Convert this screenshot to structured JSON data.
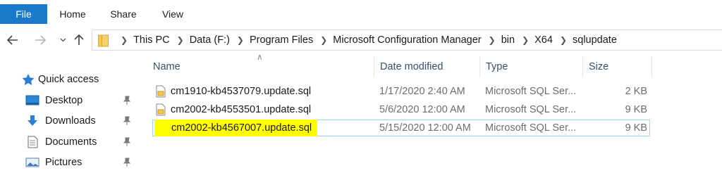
{
  "ribbon": {
    "tabs": [
      "File",
      "Home",
      "Share",
      "View"
    ]
  },
  "address": {
    "crumbs": [
      "This PC",
      "Data (F:)",
      "Program Files",
      "Microsoft Configuration Manager",
      "bin",
      "X64",
      "sqlupdate"
    ]
  },
  "navpane": {
    "items": [
      {
        "label": "Quick access",
        "icon": "star-icon",
        "pinned": false
      },
      {
        "label": "Desktop",
        "icon": "desktop-icon",
        "pinned": true
      },
      {
        "label": "Downloads",
        "icon": "download-arrow-icon",
        "pinned": true
      },
      {
        "label": "Documents",
        "icon": "document-icon",
        "pinned": true
      },
      {
        "label": "Pictures",
        "icon": "pictures-icon",
        "pinned": true
      }
    ]
  },
  "list": {
    "columns": {
      "name": "Name",
      "date": "Date modified",
      "type": "Type",
      "size": "Size"
    },
    "rows": [
      {
        "name": "cm1910-kb4537079.update.sql",
        "date": "1/17/2020 2:40 AM",
        "type": "Microsoft SQL Ser...",
        "size": "2 KB",
        "selected": false
      },
      {
        "name": "cm2002-kb4553501.update.sql",
        "date": "5/6/2020 12:00 AM",
        "type": "Microsoft SQL Ser...",
        "size": "9 KB",
        "selected": false
      },
      {
        "name": "cm2002-kb4567007.update.sql",
        "date": "5/15/2020 12:00 AM",
        "type": "Microsoft SQL Ser...",
        "size": "9 KB",
        "selected": true
      }
    ]
  },
  "colors": {
    "file_tab": "#1979ca",
    "selection_border": "#99d1ff",
    "highlight": "#ffff00",
    "folder": "#f3c84b"
  }
}
